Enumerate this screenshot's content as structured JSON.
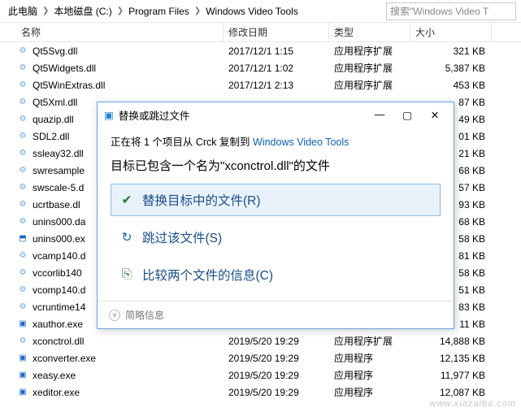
{
  "breadcrumb": {
    "seg1": "此电脑",
    "seg2": "本地磁盘 (C:)",
    "seg3": "Program Files",
    "seg4": "Windows Video Tools"
  },
  "search": {
    "placeholder": "搜索\"Windows Video T"
  },
  "columns": {
    "name": "名称",
    "date": "修改日期",
    "type": "类型",
    "size": "大小"
  },
  "icons": {
    "dll": "⚙",
    "exe_u": "⬒",
    "exe_x": "▣",
    "app": "▤"
  },
  "files": [
    {
      "name": "Qt5Svg.dll",
      "date": "2017/12/1 1:15",
      "type": "应用程序扩展",
      "size": "321 KB",
      "kind": "dll"
    },
    {
      "name": "Qt5Widgets.dll",
      "date": "2017/12/1 1:02",
      "type": "应用程序扩展",
      "size": "5,387 KB",
      "kind": "dll"
    },
    {
      "name": "Qt5WinExtras.dll",
      "date": "2017/12/1 2:13",
      "type": "应用程序扩展",
      "size": "453 KB",
      "kind": "dll"
    },
    {
      "name": "Qt5Xml.dll",
      "date": "",
      "type": "",
      "size": "87 KB",
      "kind": "dll"
    },
    {
      "name": "quazip.dll",
      "date": "",
      "type": "",
      "size": "49 KB",
      "kind": "dll"
    },
    {
      "name": "SDL2.dll",
      "date": "",
      "type": "",
      "size": "01 KB",
      "kind": "dll"
    },
    {
      "name": "ssleay32.dll",
      "date": "",
      "type": "",
      "size": "21 KB",
      "kind": "dll"
    },
    {
      "name": "swresample",
      "date": "",
      "type": "",
      "size": "68 KB",
      "kind": "dll"
    },
    {
      "name": "swscale-5.d",
      "date": "",
      "type": "",
      "size": "57 KB",
      "kind": "dll"
    },
    {
      "name": "ucrtbase.dl",
      "date": "",
      "type": "",
      "size": "93 KB",
      "kind": "dll"
    },
    {
      "name": "unins000.da",
      "date": "",
      "type": "",
      "size": "68 KB",
      "kind": "dll"
    },
    {
      "name": "unins000.ex",
      "date": "",
      "type": "",
      "size": "58 KB",
      "kind": "exe_u"
    },
    {
      "name": "vcamp140.d",
      "date": "",
      "type": "",
      "size": "81 KB",
      "kind": "dll"
    },
    {
      "name": "vccorlib140",
      "date": "",
      "type": "",
      "size": "58 KB",
      "kind": "dll"
    },
    {
      "name": "vcomp140.d",
      "date": "",
      "type": "",
      "size": "51 KB",
      "kind": "dll"
    },
    {
      "name": "vcruntime14",
      "date": "",
      "type": "",
      "size": "83 KB",
      "kind": "dll"
    },
    {
      "name": "xauthor.exe",
      "date": "",
      "type": "",
      "size": "11 KB",
      "kind": "exe_x"
    },
    {
      "name": "xconctrol.dll",
      "date": "2019/5/20 19:29",
      "type": "应用程序扩展",
      "size": "14,888 KB",
      "kind": "dll"
    },
    {
      "name": "xconverter.exe",
      "date": "2019/5/20 19:29",
      "type": "应用程序",
      "size": "12,135 KB",
      "kind": "exe_x"
    },
    {
      "name": "xeasy.exe",
      "date": "2019/5/20 19:29",
      "type": "应用程序",
      "size": "11,977 KB",
      "kind": "exe_x"
    },
    {
      "name": "xeditor.exe",
      "date": "2019/5/20 19:29",
      "type": "应用程序",
      "size": "12,087 KB",
      "kind": "exe_x"
    }
  ],
  "dialog": {
    "title": "替换或跳过文件",
    "line_pre": "正在将 1 个项目从 Crck 复制到 ",
    "line_link": "Windows Video Tools",
    "message": "目标已包含一个名为\"xconctrol.dll\"的文件",
    "opt_replace": "替换目标中的文件(R)",
    "opt_skip": "跳过该文件(S)",
    "opt_compare": "比较两个文件的信息(C)",
    "more": "简略信息"
  },
  "watermark": "www.xiazaiba.com"
}
